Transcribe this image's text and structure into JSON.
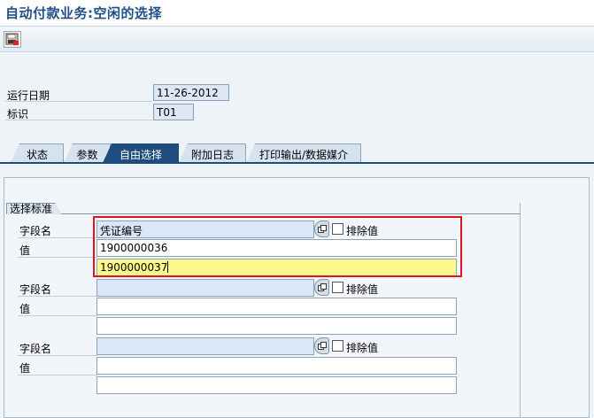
{
  "window": {
    "title": "自动付款业务:空闲的选择"
  },
  "toolbar": {
    "save_icon": "save-variant-icon"
  },
  "header": {
    "run_date_label": "运行日期",
    "run_date_value": "11-26-2012",
    "id_label": "标识",
    "id_value": "T01"
  },
  "tabs": [
    {
      "label": "状态"
    },
    {
      "label": "参数"
    },
    {
      "label": "自由选择"
    },
    {
      "label": "附加日志"
    },
    {
      "label": "打印输出/数据媒介"
    }
  ],
  "active_tab": "自由选择",
  "selection": {
    "group_title": "选择标准",
    "field_name_label": "字段名",
    "value_label": "值",
    "exclude_label": "排除值",
    "blocks": [
      {
        "field_name": "凭证编号",
        "exclude": false,
        "values": [
          "1900000036",
          "1900000037"
        ]
      },
      {
        "field_name": "",
        "exclude": false,
        "values": [
          "",
          ""
        ]
      },
      {
        "field_name": "",
        "exclude": false,
        "values": [
          "",
          ""
        ]
      }
    ]
  },
  "colors": {
    "title": "#1f4f86",
    "active_tab": "#1e4c7c",
    "highlight": "#e0141e",
    "focus_field": "#fcf98c"
  }
}
